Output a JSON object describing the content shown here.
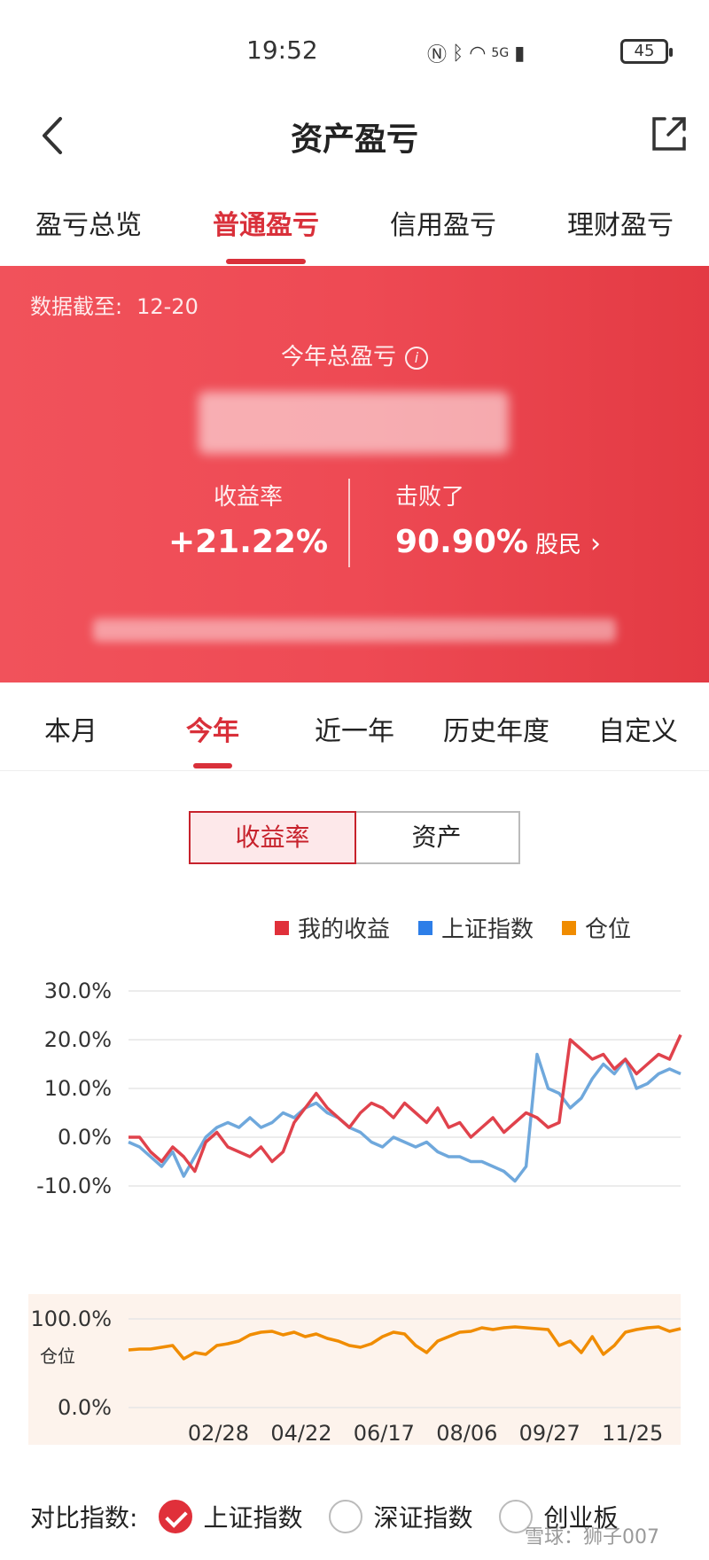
{
  "status": {
    "time": "19:52",
    "battery": "45",
    "signal": "5G"
  },
  "nav": {
    "title": "资产盈亏"
  },
  "top_tabs": [
    {
      "label": "盈亏总览",
      "active": false
    },
    {
      "label": "普通盈亏",
      "active": true
    },
    {
      "label": "信用盈亏",
      "active": false
    },
    {
      "label": "理财盈亏",
      "active": false
    }
  ],
  "banner": {
    "date_label": "数据截至:",
    "date_value": "12-20",
    "year_label": "今年总盈亏",
    "return_label": "收益率",
    "return_value": "+21.22%",
    "beat_label": "击败了",
    "beat_value": "90.90%",
    "beat_suffix": "股民"
  },
  "period_tabs": [
    {
      "label": "本月",
      "active": false
    },
    {
      "label": "今年",
      "active": true
    },
    {
      "label": "近一年",
      "active": false
    },
    {
      "label": "历史年度",
      "active": false
    },
    {
      "label": "自定义",
      "active": false
    }
  ],
  "toggle": {
    "return_label": "收益率",
    "asset_label": "资产"
  },
  "colors": {
    "accent": "#d9303a",
    "my": "#e0424c",
    "index": "#6fa8dc",
    "position": "#f08c00"
  },
  "chart_data": [
    {
      "type": "line",
      "ylim": [
        -10,
        30
      ],
      "y_ticks": [
        "30.0%",
        "20.0%",
        "10.0%",
        "0.0%",
        "-10.0%"
      ],
      "y_tick_values": [
        30,
        20,
        10,
        0,
        -10
      ],
      "x_range": [
        0,
        100
      ],
      "legend": [
        "我的收益",
        "上证指数",
        "仓位"
      ],
      "series": [
        {
          "name": "我的收益",
          "color": "#e0424c",
          "x": [
            0,
            2,
            4,
            6,
            8,
            10,
            12,
            14,
            16,
            18,
            20,
            22,
            24,
            26,
            28,
            30,
            32,
            34,
            36,
            38,
            40,
            42,
            44,
            46,
            48,
            50,
            52,
            54,
            56,
            58,
            60,
            62,
            64,
            66,
            68,
            70,
            72,
            74,
            76,
            78,
            80,
            82,
            84,
            86,
            88,
            90,
            92,
            94,
            96,
            98,
            100
          ],
          "y": [
            0,
            0,
            -3,
            -5,
            -2,
            -4,
            -7,
            -1,
            1,
            -2,
            -3,
            -4,
            -2,
            -5,
            -3,
            3,
            6,
            9,
            6,
            4,
            2,
            5,
            7,
            6,
            4,
            7,
            5,
            3,
            6,
            2,
            3,
            0,
            2,
            4,
            1,
            3,
            5,
            4,
            2,
            3,
            20,
            18,
            16,
            17,
            14,
            16,
            13,
            15,
            17,
            16,
            21
          ]
        },
        {
          "name": "上证指数",
          "color": "#6fa8dc",
          "x": [
            0,
            2,
            4,
            6,
            8,
            10,
            12,
            14,
            16,
            18,
            20,
            22,
            24,
            26,
            28,
            30,
            32,
            34,
            36,
            38,
            40,
            42,
            44,
            46,
            48,
            50,
            52,
            54,
            56,
            58,
            60,
            62,
            64,
            66,
            68,
            70,
            72,
            74,
            76,
            78,
            80,
            82,
            84,
            86,
            88,
            90,
            92,
            94,
            96,
            98,
            100
          ],
          "y": [
            -1,
            -2,
            -4,
            -6,
            -3,
            -8,
            -4,
            0,
            2,
            3,
            2,
            4,
            2,
            3,
            5,
            4,
            6,
            7,
            5,
            4,
            2,
            1,
            -1,
            -2,
            0,
            -1,
            -2,
            -1,
            -3,
            -4,
            -4,
            -5,
            -5,
            -6,
            -7,
            -9,
            -6,
            17,
            10,
            9,
            6,
            8,
            12,
            15,
            13,
            16,
            10,
            11,
            13,
            14,
            13
          ]
        }
      ]
    },
    {
      "type": "line",
      "ylim": [
        0,
        100
      ],
      "y_ticks": [
        "100.0%",
        "0.0%"
      ],
      "y_tick_values": [
        100,
        0
      ],
      "ylabel": "仓位",
      "x_ticks": [
        "02/28",
        "04/22",
        "06/17",
        "08/06",
        "09/27",
        "11/25"
      ],
      "x_tick_positions": [
        15,
        30,
        45,
        60,
        75,
        90
      ],
      "x_range": [
        0,
        100
      ],
      "series": [
        {
          "name": "仓位",
          "color": "#f08c00",
          "x": [
            0,
            2,
            4,
            6,
            8,
            10,
            12,
            14,
            16,
            18,
            20,
            22,
            24,
            26,
            28,
            30,
            32,
            34,
            36,
            38,
            40,
            42,
            44,
            46,
            48,
            50,
            52,
            54,
            56,
            58,
            60,
            62,
            64,
            66,
            68,
            70,
            72,
            74,
            76,
            78,
            80,
            82,
            84,
            86,
            88,
            90,
            92,
            94,
            96,
            98,
            100
          ],
          "y": [
            65,
            66,
            66,
            68,
            70,
            55,
            62,
            60,
            70,
            72,
            75,
            82,
            85,
            86,
            82,
            85,
            80,
            83,
            78,
            75,
            70,
            68,
            72,
            80,
            85,
            83,
            70,
            62,
            75,
            80,
            85,
            86,
            90,
            88,
            90,
            91,
            90,
            89,
            88,
            70,
            75,
            62,
            80,
            60,
            70,
            85,
            88,
            90,
            91,
            86,
            89
          ]
        }
      ]
    }
  ],
  "compare": {
    "label": "对比指数:",
    "options": [
      {
        "label": "上证指数",
        "checked": true
      },
      {
        "label": "深证指数",
        "checked": false
      },
      {
        "label": "创业板",
        "checked": false
      }
    ]
  },
  "watermark": "雪球：狮子007"
}
